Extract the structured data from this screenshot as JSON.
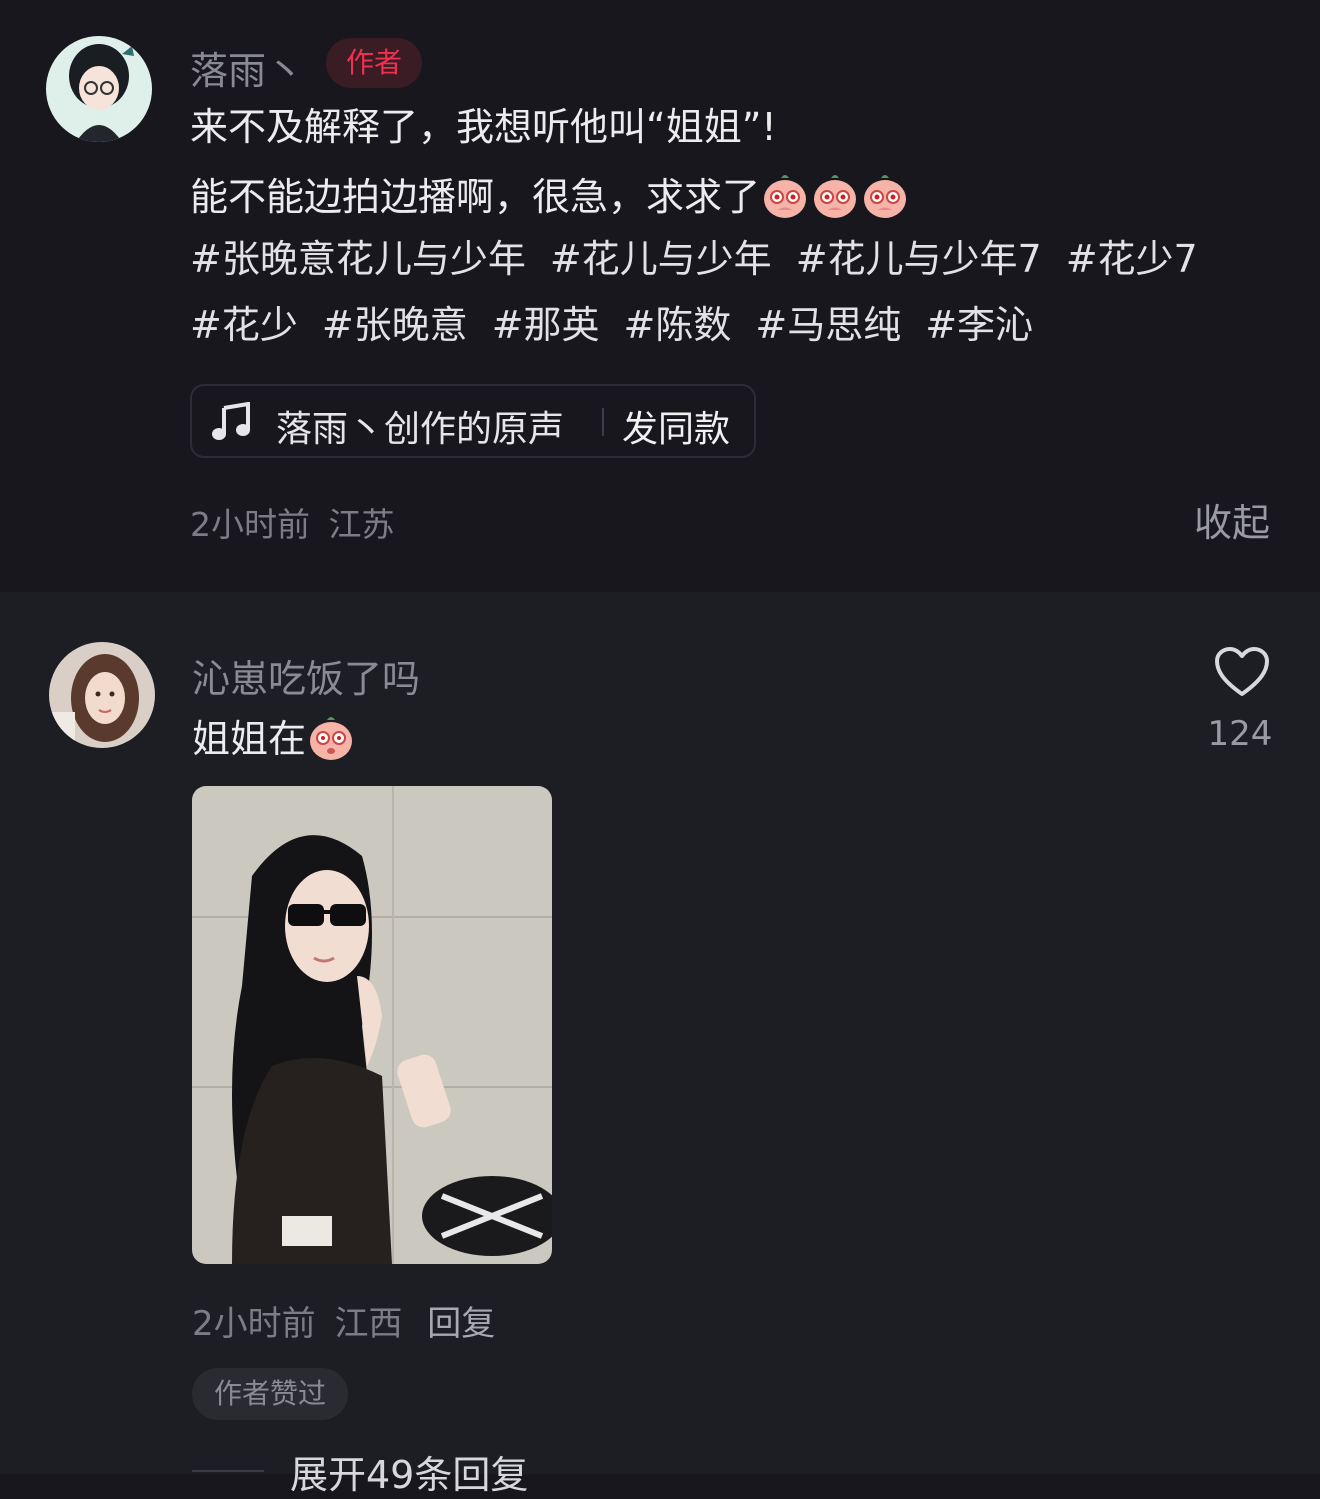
{
  "comment": {
    "username": "落雨丶",
    "badge": "作者",
    "line1": "来不及解释了，我想听他叫“姐姐”!",
    "line2": "能不能边拍边播啊，很急，求求了",
    "hashtags_row1": [
      "#张晚意花儿与少年",
      "#花儿与少年",
      "#花儿与少年7",
      "#花少7"
    ],
    "hashtags_row2": [
      "#花少",
      "#张晚意",
      "#那英",
      "#陈数",
      "#马思纯",
      "#李沁"
    ],
    "music": {
      "label": "落雨丶创作的原声",
      "action": "发同款"
    },
    "time": "2小时前",
    "location": "江苏",
    "collapse_label": "收起"
  },
  "reply": {
    "username": "沁崽吃饭了吗",
    "text": "姐姐在",
    "like_count": "124",
    "time": "2小时前",
    "location": "江西",
    "reply_label": "回复",
    "liked_badge": "作者赞过",
    "expand_label": "展开49条回复"
  }
}
